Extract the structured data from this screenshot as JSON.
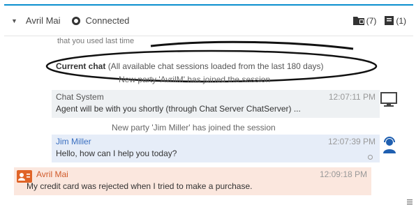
{
  "header": {
    "party_name": "Avril Mai",
    "status": "Connected",
    "counters": [
      {
        "icon": "folder-icon",
        "label": "(7)"
      },
      {
        "icon": "document-icon",
        "label": "(1)"
      }
    ]
  },
  "transcript": {
    "cut_off_text": "that you used last time",
    "current_chat_title": "Current chat",
    "current_chat_subtitle": "(All available chat sessions loaded from the last 180 days)",
    "join_notice_1": "New party 'AvrilM' has joined the session",
    "join_notice_2": "New party 'Jim Miller' has joined the session",
    "messages": [
      {
        "sender": "Chat System",
        "time": "12:07:11 PM",
        "text": "Agent will be with you shortly (through Chat Server ChatServer) ..."
      },
      {
        "sender": "Jim Miller",
        "time": "12:07:39 PM",
        "text": "Hello, how can I help you today?"
      },
      {
        "sender": "Avril Mai",
        "time": "12:09:18 PM",
        "text": "My credit card was rejected when I tried to make a purchase."
      }
    ]
  },
  "colors": {
    "accent": "#0a8fce",
    "system_bg": "#eef1f3",
    "agent_bg": "#e6edf8",
    "agent_name": "#3a6fc0",
    "customer_bg": "#fbe7de",
    "customer_name": "#d05a2a",
    "customer_icon": "#e06428"
  }
}
